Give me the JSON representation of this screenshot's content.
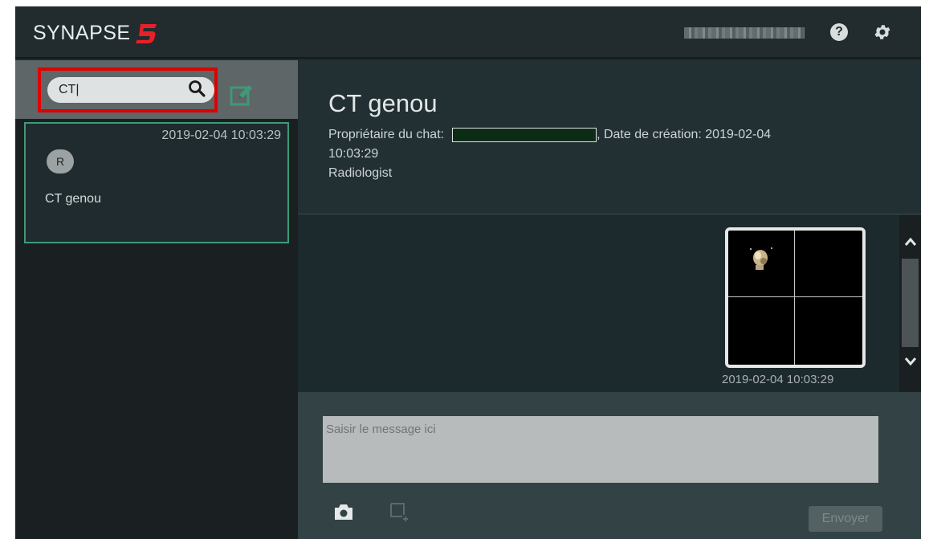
{
  "app": {
    "logo_text": "SYNAPSE",
    "logo_mark": "5",
    "user_name": "",
    "icons": {
      "help": "question-circle-icon",
      "settings": "gear-icon"
    }
  },
  "sidebar": {
    "search": {
      "value": "CT|",
      "placeholder": ""
    },
    "new_chat_icon": "edit-icon",
    "chat_items": [
      {
        "time": "2019-02-04 10:03:29",
        "avatar": "R",
        "title": "CT genou"
      }
    ]
  },
  "chat": {
    "title": "CT genou",
    "owner_label": "Propriétaire du chat:",
    "owner_name": "",
    "created_label": ", Date de création: 2019-02-04",
    "created_time": "10:03:29",
    "participants": "Radiologist",
    "messages": [
      {
        "type": "image",
        "time": "2019-02-04 10:03:29"
      }
    ]
  },
  "composer": {
    "placeholder": "Saisir le message ici",
    "send_label": "Envoyer",
    "icons": {
      "camera": "camera-icon",
      "crop": "crop-icon"
    }
  },
  "colors": {
    "accent_green": "#3e9a77",
    "logo_red": "#e8202a",
    "highlight_red": "#e00000"
  }
}
